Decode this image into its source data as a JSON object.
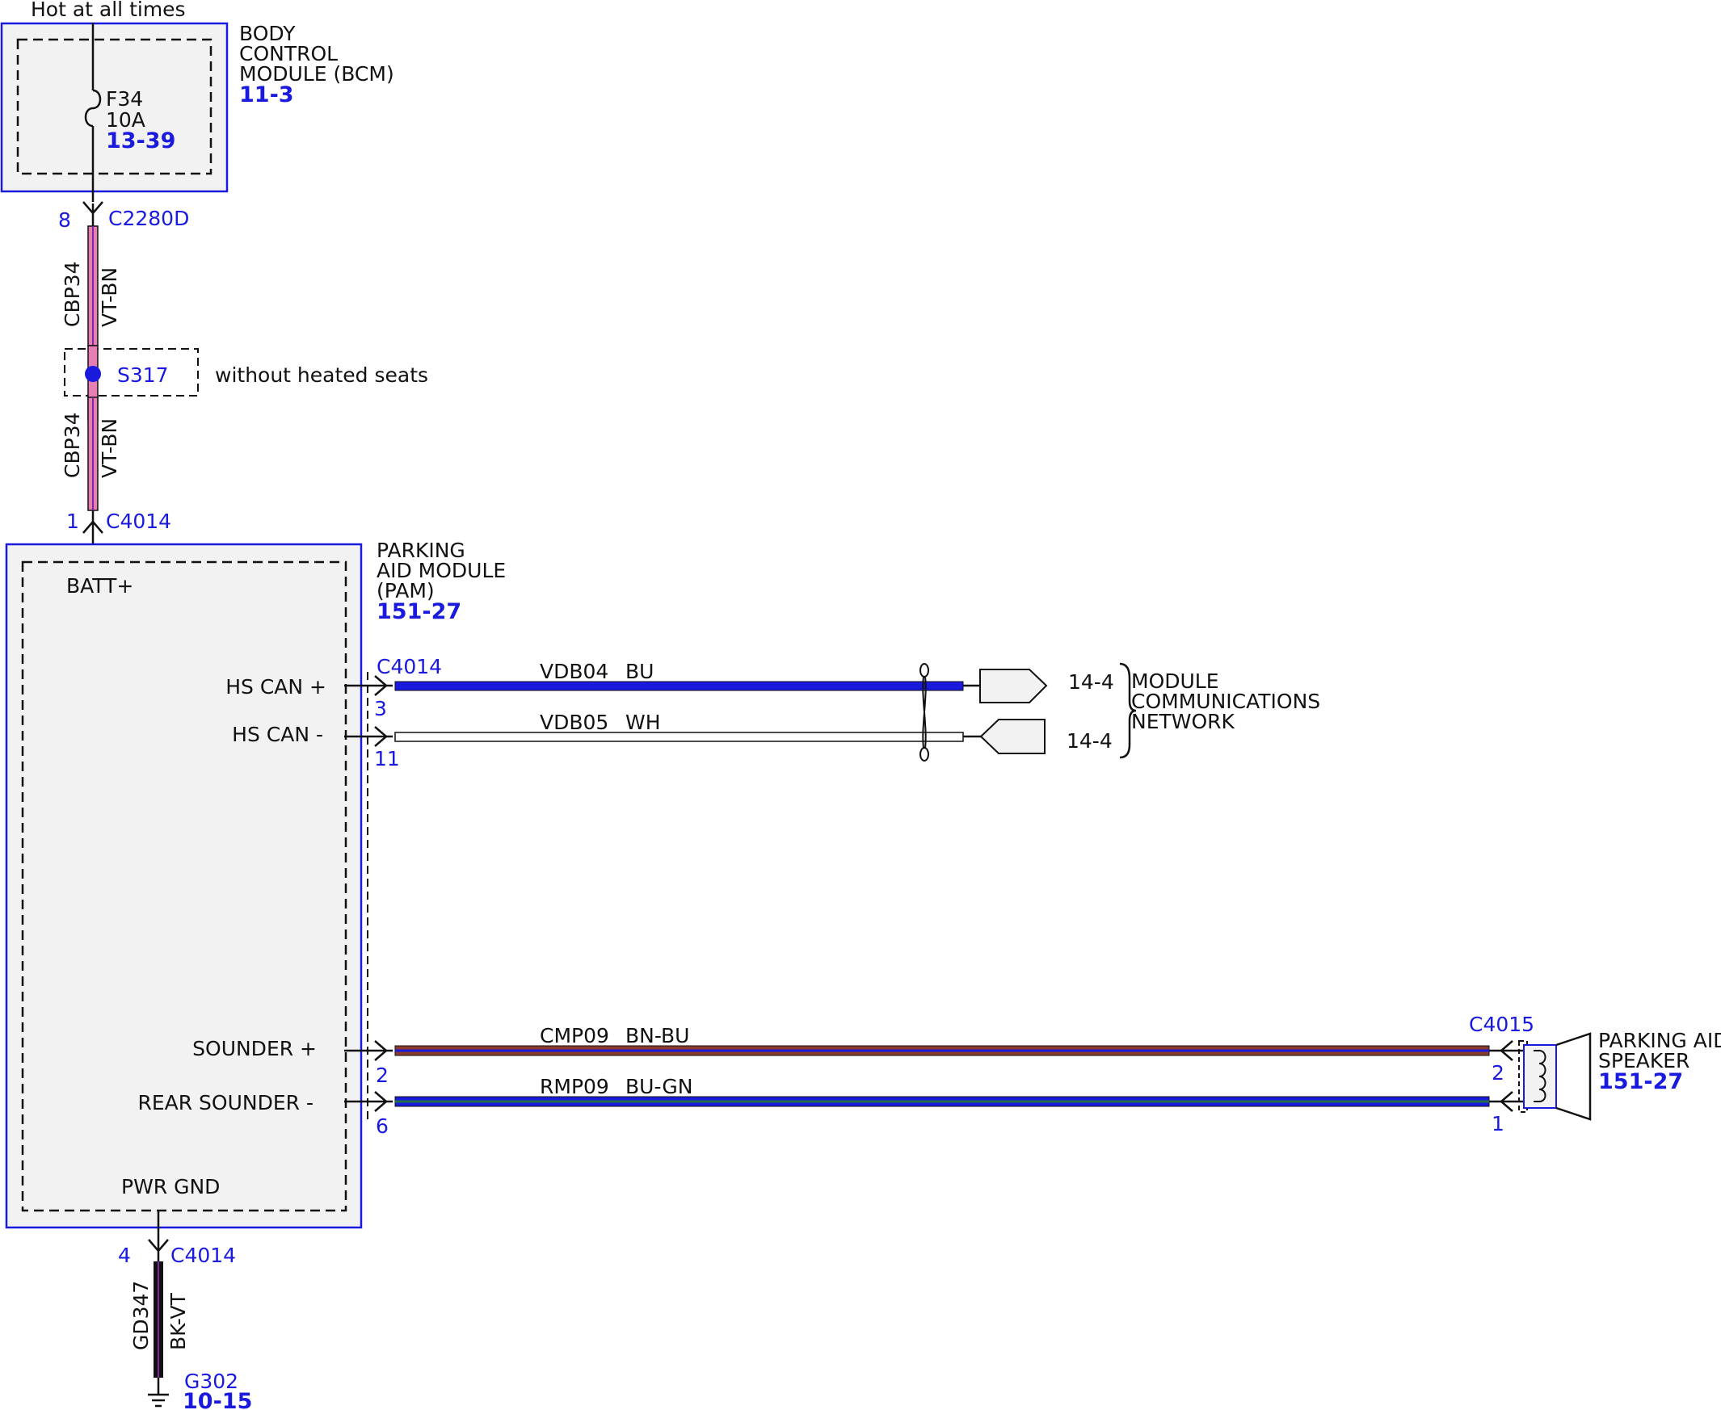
{
  "colors": {
    "module_border": "#1a1adf",
    "module_fill": "#f2f2f2",
    "connector_text": "#1a1adf",
    "wire_vt_bn": "#e57fb4",
    "wire_bu": "#1a1adf",
    "wire_wh": "#ffffff",
    "wire_bn_bu": "#8b3b2b",
    "wire_bu_gn": "#1a1adf",
    "wire_bk_vt": "#111111",
    "splice": "#1a1adf"
  },
  "top": {
    "supply_label": "Hot at all times"
  },
  "bcm": {
    "name_line1": "BODY",
    "name_line2": "CONTROL",
    "name_line3": "MODULE (BCM)",
    "ref": "11-3",
    "fuse_name": "F34",
    "fuse_rating": "10A",
    "fuse_ref": "13-39"
  },
  "wire_batt": {
    "top_pin": "8",
    "top_connector": "C2280D",
    "circuit": "CBP34",
    "color_code": "VT-BN",
    "splice_name": "S317",
    "splice_note": "without heated seats",
    "bottom_pin": "1",
    "bottom_connector": "C4014"
  },
  "pam": {
    "name_line1": "PARKING",
    "name_line2": "AID MODULE",
    "name_line3": "(PAM)",
    "ref": "151-27",
    "batt_label": "BATT+",
    "pwr_gnd_label": "PWR GND",
    "connector": "C4014",
    "pins": [
      {
        "label": "HS CAN +",
        "pin": "3"
      },
      {
        "label": "HS CAN -",
        "pin": "11"
      },
      {
        "label": "SOUNDER +",
        "pin": "2"
      },
      {
        "label": "REAR SOUNDER -",
        "pin": "6"
      }
    ]
  },
  "can_wires": [
    {
      "circuit": "VDB04",
      "color_code": "BU",
      "ref": "14-4"
    },
    {
      "circuit": "VDB05",
      "color_code": "WH",
      "ref": "14-4"
    }
  ],
  "network": {
    "line1": "MODULE",
    "line2": "COMMUNICATIONS",
    "line3": "NETWORK"
  },
  "sounder_wires": [
    {
      "circuit": "CMP09",
      "color_code": "BN-BU",
      "speaker_pin": "2"
    },
    {
      "circuit": "RMP09",
      "color_code": "BU-GN",
      "speaker_pin": "1"
    }
  ],
  "speaker": {
    "connector": "C4015",
    "name_line1": "PARKING AID",
    "name_line2": "SPEAKER",
    "ref": "151-27"
  },
  "ground": {
    "pin": "4",
    "connector": "C4014",
    "circuit": "GD347",
    "color_code": "BK-VT",
    "ground_name": "G302",
    "ref": "10-15"
  }
}
